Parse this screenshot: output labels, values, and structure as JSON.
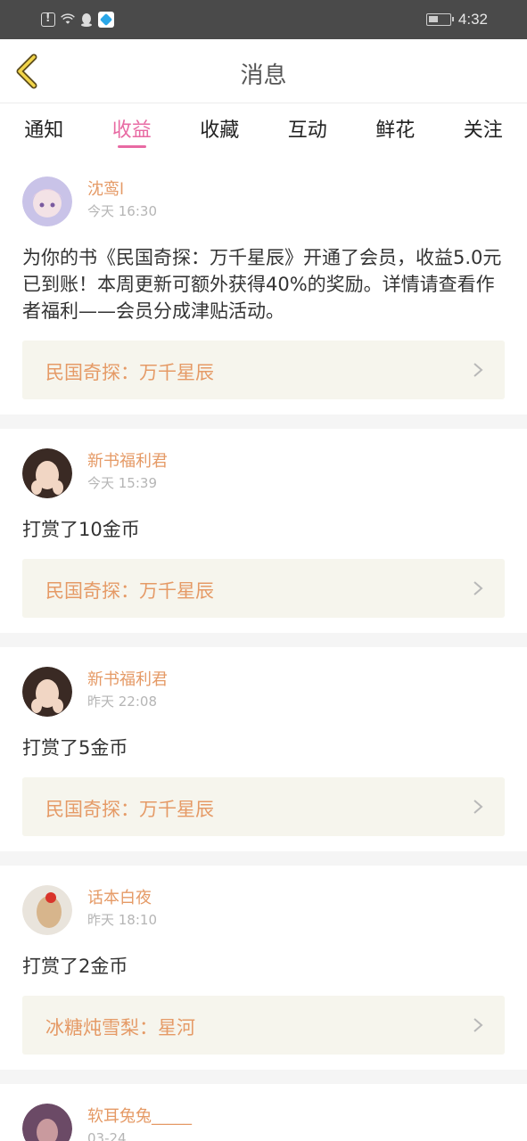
{
  "status_bar": {
    "time": "4:32",
    "icons": [
      "alert-icon",
      "wifi-icon",
      "qq-icon",
      "app-icon",
      "battery-icon"
    ]
  },
  "header": {
    "title": "消息",
    "back_icon": "chevron-left-icon"
  },
  "tabs": [
    {
      "label": "通知",
      "active": false
    },
    {
      "label": "收益",
      "active": true
    },
    {
      "label": "收藏",
      "active": false
    },
    {
      "label": "互动",
      "active": false
    },
    {
      "label": "鲜花",
      "active": false
    },
    {
      "label": "关注",
      "active": false
    }
  ],
  "colors": {
    "accent_pink": "#e86aa3",
    "name_orange": "#e59a66",
    "link_bg": "#f6f5ed",
    "status_bar_bg": "#4a4a4a"
  },
  "messages": [
    {
      "user": "沈鸾l",
      "time": "今天 16:30",
      "text": "为你的书《民国奇探：万千星辰》开通了会员，收益5.0元已到账！本周更新可额外获得40%的奖励。详情请查看作者福利——会员分成津贴活动。",
      "book": "民国奇探：万千星辰"
    },
    {
      "user": "新书福利君",
      "time": "今天 15:39",
      "text": "打赏了10金币",
      "book": "民国奇探：万千星辰"
    },
    {
      "user": "新书福利君",
      "time": "昨天 22:08",
      "text": "打赏了5金币",
      "book": "民国奇探：万千星辰"
    },
    {
      "user": "话本白夜",
      "time": "昨天 18:10",
      "text": "打赏了2金币",
      "book": "冰糖炖雪梨：星河"
    },
    {
      "user": "软耳兔兔_____",
      "time": "03-24"
    }
  ]
}
